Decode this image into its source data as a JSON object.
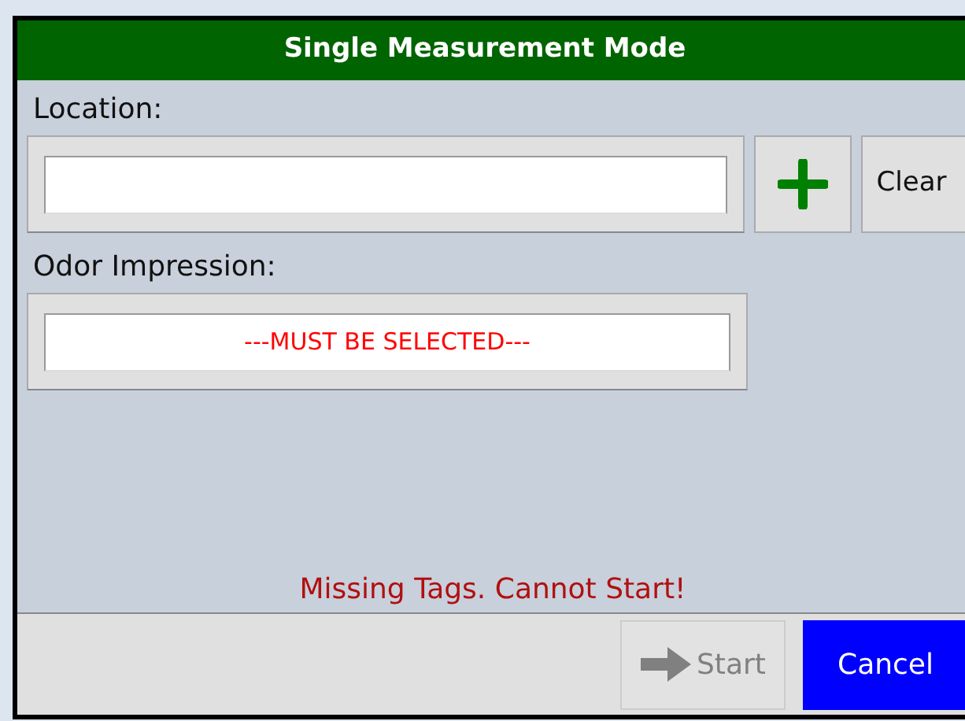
{
  "window": {
    "title": "Single Measurement Mode"
  },
  "location": {
    "label": "Location:",
    "clear_button": "Clear"
  },
  "odor": {
    "label": "Odor Impression:",
    "value": "---MUST BE SELECTED---"
  },
  "status": "Missing Tags. Cannot Start!",
  "buttons": [
    {
      "label": "Start",
      "kind": "start",
      "disabled": true
    },
    {
      "label": "Cancel",
      "kind": "cancel",
      "disabled": false
    }
  ]
}
